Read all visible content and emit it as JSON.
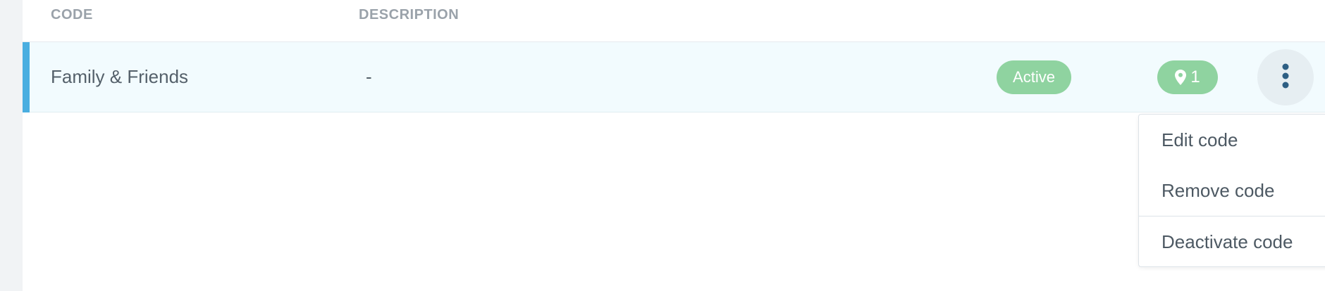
{
  "table": {
    "headers": {
      "code": "CODE",
      "description": "DESCRIPTION"
    },
    "rows": [
      {
        "code": "Family & Friends",
        "description": "-",
        "status": "Active",
        "location_count": "1"
      }
    ]
  },
  "row_menu": {
    "items": [
      {
        "label": "Edit code"
      },
      {
        "label": "Remove code"
      },
      {
        "label": "Deactivate code"
      }
    ]
  },
  "icons": {
    "location": "map-pin-icon",
    "more": "vertical-dots-icon"
  },
  "colors": {
    "accent": "#4aaee0",
    "row_bg": "#f2fbfe",
    "badge_green": "#8fd3a0",
    "header_text": "#9aa2aa",
    "body_text": "#54606a",
    "kebab": "#2d5f84"
  }
}
